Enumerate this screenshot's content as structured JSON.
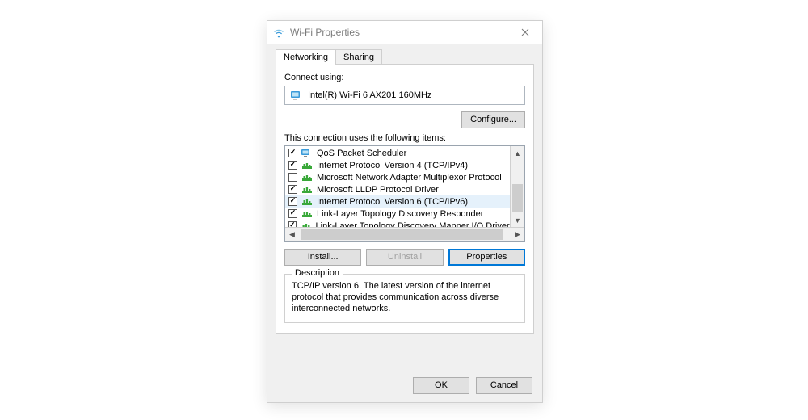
{
  "window": {
    "title": "Wi-Fi Properties"
  },
  "tabs": {
    "networking": "Networking",
    "sharing": "Sharing"
  },
  "connect_using_label": "Connect using:",
  "adapter_name": "Intel(R) Wi-Fi 6 AX201 160MHz",
  "configure_btn": "Configure...",
  "items_label": "This connection uses the following items:",
  "items": [
    {
      "checked": true,
      "name": "QoS Packet Scheduler",
      "iconColor": "adapter"
    },
    {
      "checked": true,
      "name": "Internet Protocol Version 4 (TCP/IPv4)",
      "iconColor": "net"
    },
    {
      "checked": false,
      "name": "Microsoft Network Adapter Multiplexor Protocol",
      "iconColor": "net"
    },
    {
      "checked": true,
      "name": "Microsoft LLDP Protocol Driver",
      "iconColor": "net"
    },
    {
      "checked": true,
      "name": "Internet Protocol Version 6 (TCP/IPv6)",
      "iconColor": "net",
      "selected": true
    },
    {
      "checked": true,
      "name": "Link-Layer Topology Discovery Responder",
      "iconColor": "net"
    },
    {
      "checked": true,
      "name": "Link-Layer Topology Discovery Mapper I/O Driver",
      "iconColor": "net"
    }
  ],
  "install_btn": "Install...",
  "uninstall_btn": "Uninstall",
  "properties_btn": "Properties",
  "description": {
    "legend": "Description",
    "text": "TCP/IP version 6. The latest version of the internet protocol that provides communication across diverse interconnected networks."
  },
  "footer": {
    "ok": "OK",
    "cancel": "Cancel"
  }
}
